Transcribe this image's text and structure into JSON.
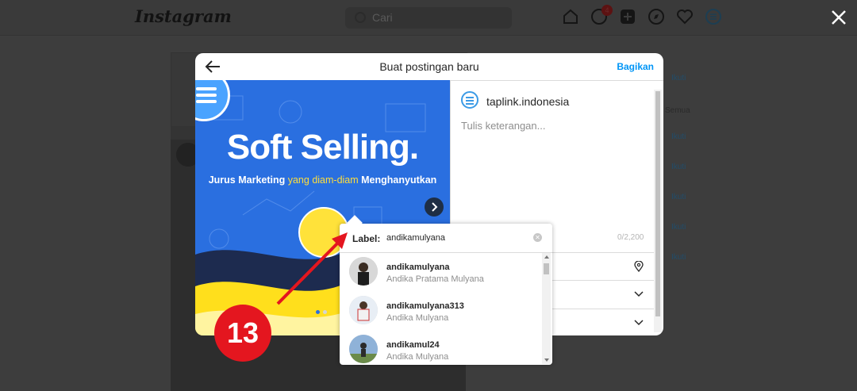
{
  "topbar": {
    "logo": "Instagram",
    "search_placeholder": "Cari",
    "notification_count": "4"
  },
  "sidebar": {
    "links": [
      "Ikuti",
      "Ikuti",
      "Ikuti",
      "Ikuti",
      "Ikuti"
    ],
    "see_all": "Semua",
    "top_link": "Ikuti"
  },
  "modal": {
    "title": "Buat postingan baru",
    "share_label": "Bagikan",
    "image": {
      "headline": "Soft Selling.",
      "sub_part1": "Jurus Marketing ",
      "sub_part2": "yang diam-diam ",
      "sub_part3": "Menghanyutkan"
    },
    "account": "taplink.indonesia",
    "caption_placeholder": "Tulis keterangan...",
    "char_counter": "0/2,200"
  },
  "tag_popup": {
    "label": "Label:",
    "query": "andikamulyana",
    "results": [
      {
        "handle": "andikamulyana",
        "name": "Andika Pratama Mulyana"
      },
      {
        "handle": "andikamulyana313",
        "name": "Andika Mulyana"
      },
      {
        "handle": "andikamul24",
        "name": "Andika Mulyana"
      }
    ]
  },
  "annotation": {
    "step_number": "13"
  },
  "colors": {
    "accent": "#0095f6",
    "step_badge": "#e4161f",
    "image_blue": "#2a6fe0",
    "headline_yellow": "#ffde3b"
  }
}
